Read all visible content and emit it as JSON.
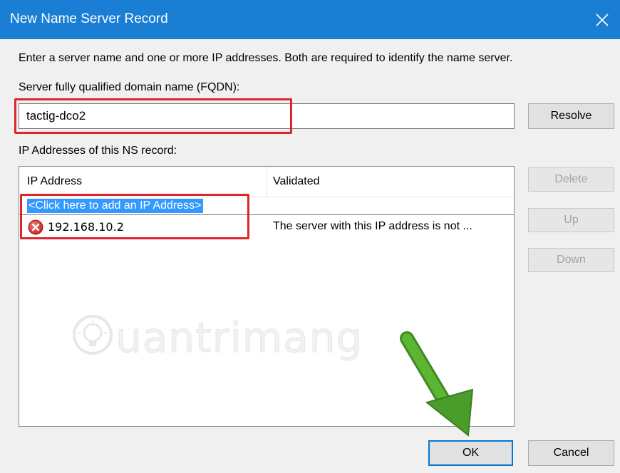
{
  "window": {
    "title": "New Name Server Record",
    "close_icon": "close-icon"
  },
  "intro_text": "Enter a server name and one or more IP addresses.  Both are required to identify the name server.",
  "fqdn": {
    "label": "Server fully qualified domain name (FQDN):",
    "value": "tactig-dco2",
    "resolve_label": "Resolve"
  },
  "ip_section": {
    "label": "IP Addresses of this NS record:",
    "columns": [
      "IP Address",
      "Validated"
    ],
    "add_placeholder": "<Click here to add an IP Address>",
    "rows": [
      {
        "status_icon": "error-icon",
        "ip": "192.168.10.2",
        "validated": "The server with this IP address is not ..."
      }
    ]
  },
  "side_buttons": {
    "delete_label": "Delete",
    "up_label": "Up",
    "down_label": "Down"
  },
  "footer": {
    "ok_label": "OK",
    "cancel_label": "Cancel"
  },
  "watermark": {
    "text": "uantrimang"
  },
  "colors": {
    "titlebar": "#1a7fd4",
    "highlight_box": "#e0242b",
    "selection": "#3399ff",
    "arrow": "#4a9d2a",
    "default_button_border": "#0078d7"
  }
}
